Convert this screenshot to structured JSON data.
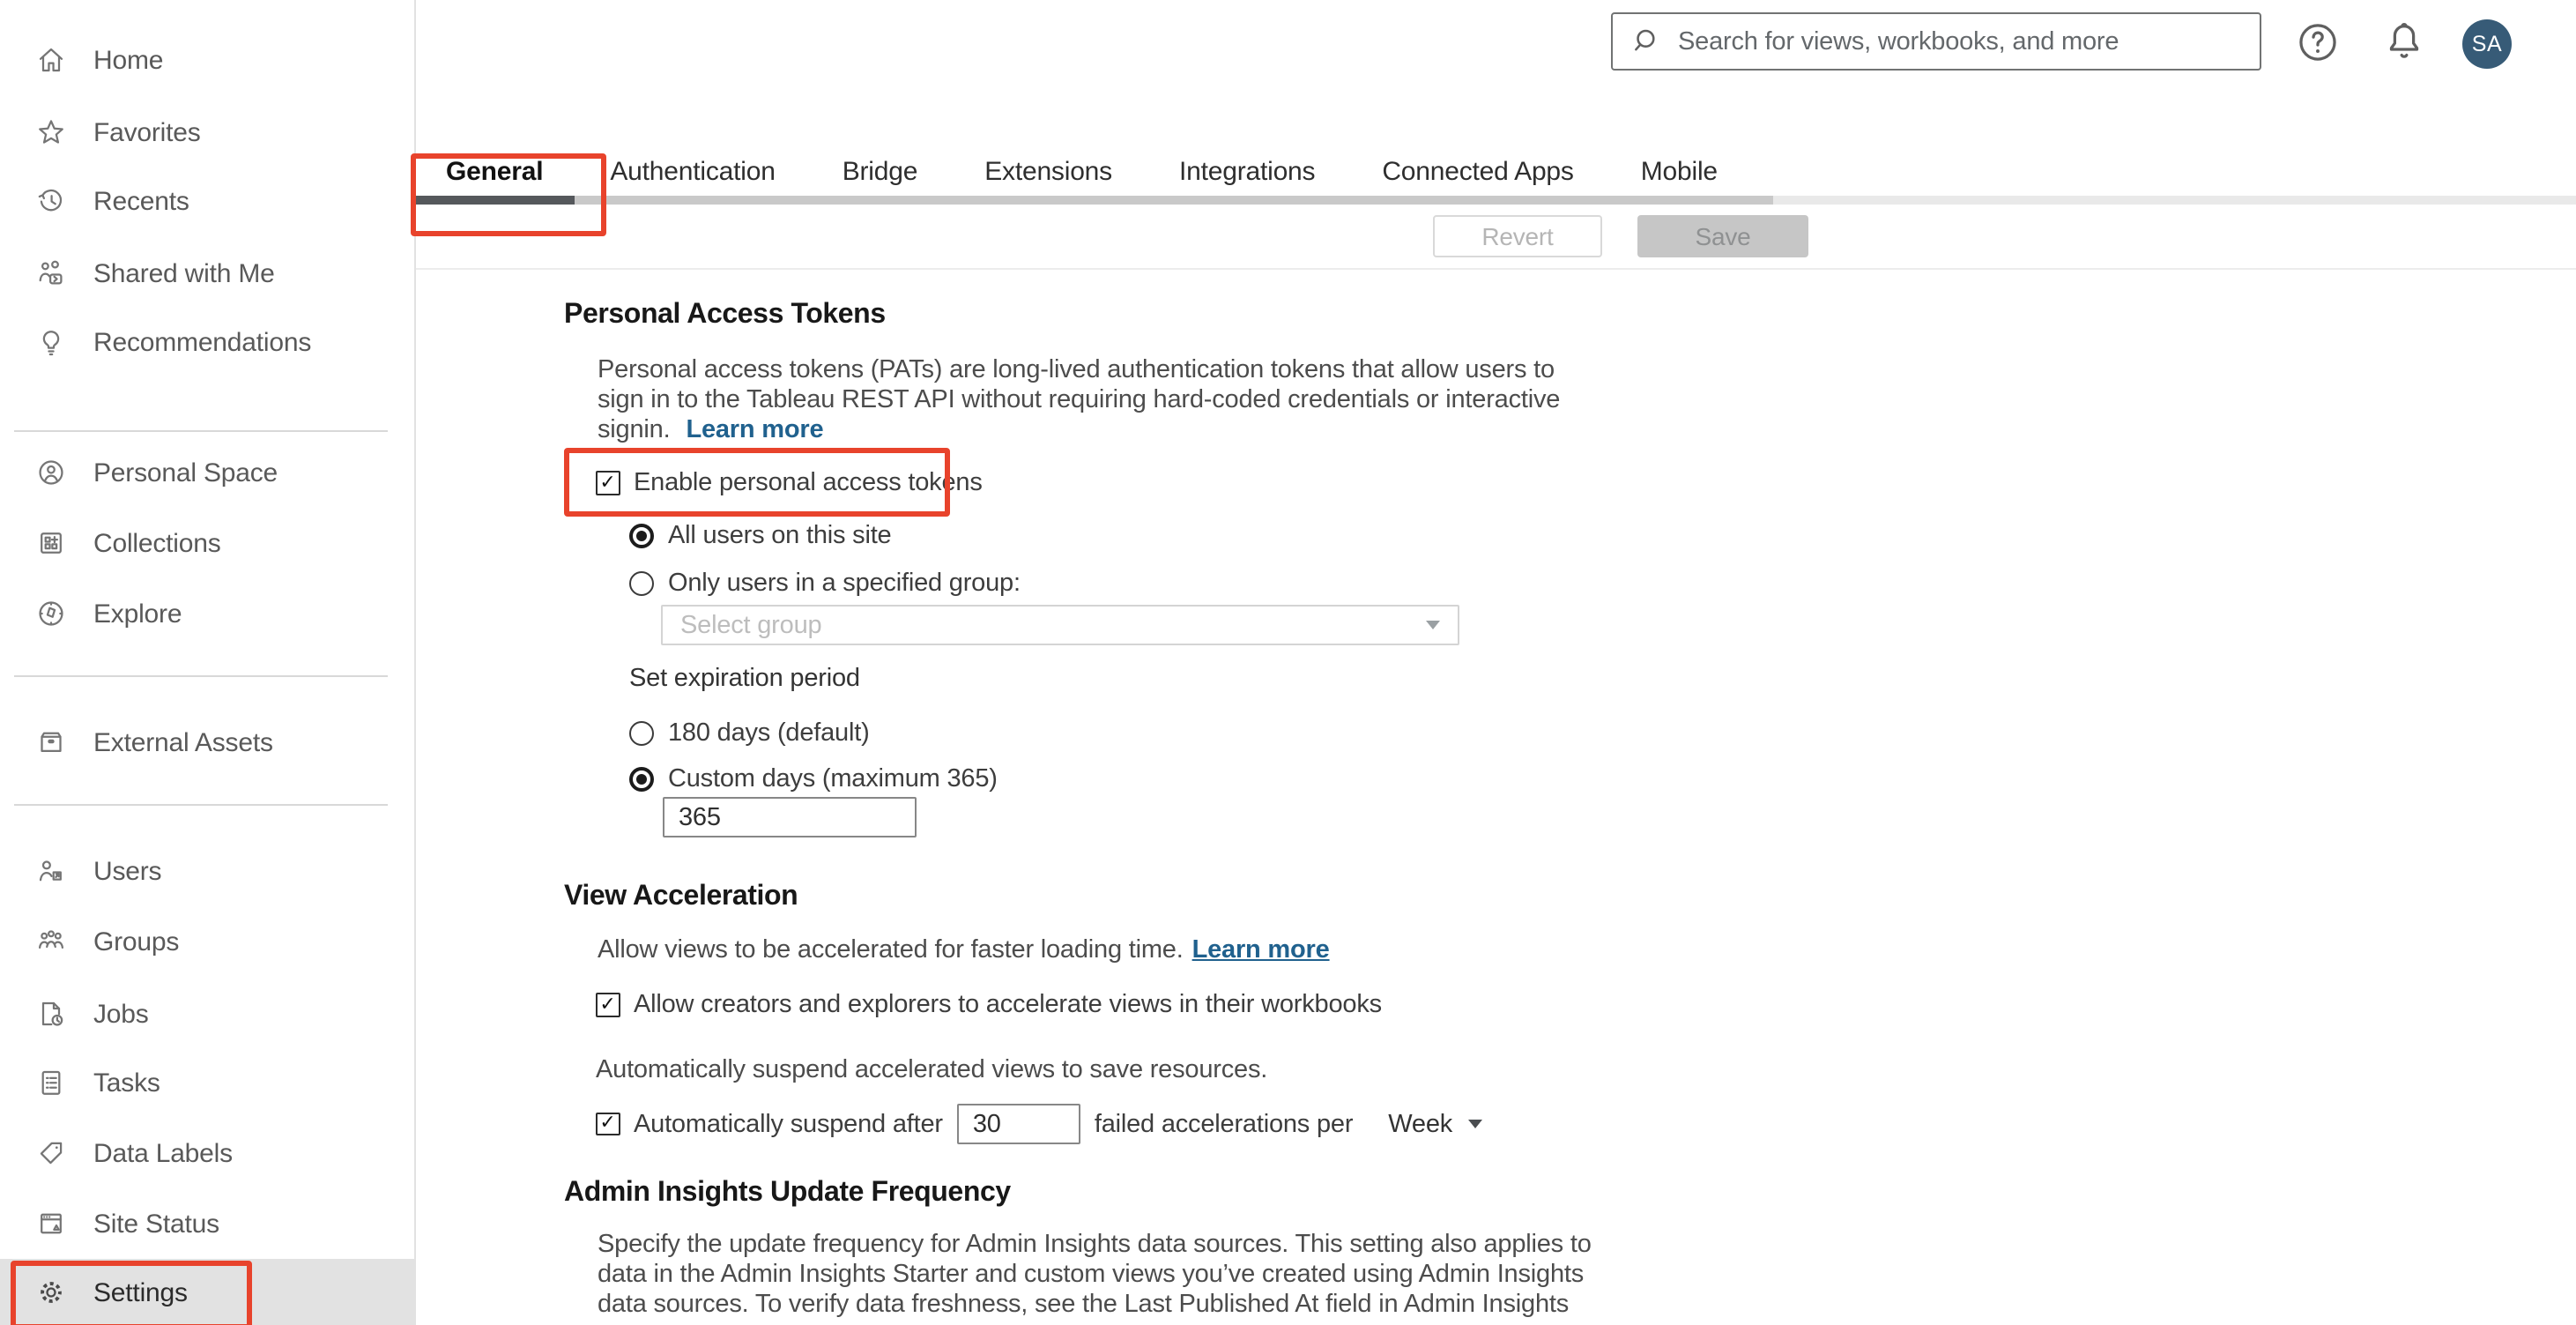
{
  "topbar": {
    "search_placeholder": "Search for views, workbooks, and more",
    "avatar_initials": "SA"
  },
  "sidebar": {
    "items": [
      {
        "label": "Home"
      },
      {
        "label": "Favorites"
      },
      {
        "label": "Recents"
      },
      {
        "label": "Shared with Me"
      },
      {
        "label": "Recommendations"
      },
      {
        "label": "Personal Space"
      },
      {
        "label": "Collections"
      },
      {
        "label": "Explore"
      },
      {
        "label": "External Assets"
      },
      {
        "label": "Users"
      },
      {
        "label": "Groups"
      },
      {
        "label": "Jobs"
      },
      {
        "label": "Tasks"
      },
      {
        "label": "Data Labels"
      },
      {
        "label": "Site Status"
      },
      {
        "label": "Settings",
        "selected": true
      }
    ]
  },
  "tabs": {
    "items": [
      {
        "label": "General",
        "active": true
      },
      {
        "label": "Authentication"
      },
      {
        "label": "Bridge"
      },
      {
        "label": "Extensions"
      },
      {
        "label": "Integrations"
      },
      {
        "label": "Connected Apps"
      },
      {
        "label": "Mobile"
      }
    ]
  },
  "toolbar": {
    "revert_label": "Revert",
    "save_label": "Save"
  },
  "sections": {
    "pat": {
      "title": "Personal Access Tokens",
      "description": "Personal access tokens (PATs) are long-lived authentication tokens that allow users to\nsign in to the Tableau REST API without requiring hard-coded credentials or interactive\nsignin.",
      "learn_more_label": "Learn more",
      "enable_checkbox_label": "Enable personal access tokens",
      "enable_checked": true,
      "scope_options": [
        {
          "label": "All users on this site",
          "selected": true
        },
        {
          "label": "Only users in a specified group:",
          "selected": false
        }
      ],
      "group_select_placeholder": "Select group",
      "expiration_label": "Set expiration period",
      "expiration_options": [
        {
          "label": "180 days (default)",
          "selected": false
        },
        {
          "label": "Custom days (maximum 365)",
          "selected": true
        }
      ],
      "custom_days_value": "365"
    },
    "view_acceleration": {
      "title": "View Acceleration",
      "description": "Allow views to be accelerated for faster loading time.",
      "learn_more_label": "Learn more",
      "allow_checkbox_label": "Allow creators and explorers to accelerate views in their workbooks",
      "allow_checked": true,
      "suspend_note": "Automatically suspend accelerated views to save resources.",
      "suspend_checkbox_label": "Automatically suspend after",
      "suspend_value": "30",
      "suspend_suffix_label": "failed accelerations per",
      "suspend_period_value": "Week",
      "suspend_checked": true
    },
    "admin_insights": {
      "title": "Admin Insights Update Frequency",
      "description": "Specify the update frequency for Admin Insights data sources. This setting also applies to\ndata in the Admin Insights Starter and custom views you’ve created using Admin Insights\ndata sources. To verify data freshness, see the Last Published At field in Admin Insights"
    }
  },
  "glyphs": {
    "check": "✓"
  },
  "colors": {
    "annotation_red": "#e8432c",
    "link_blue": "#20618e",
    "avatar_bg": "#375b77",
    "active_tab_indicator": "#55585c"
  }
}
